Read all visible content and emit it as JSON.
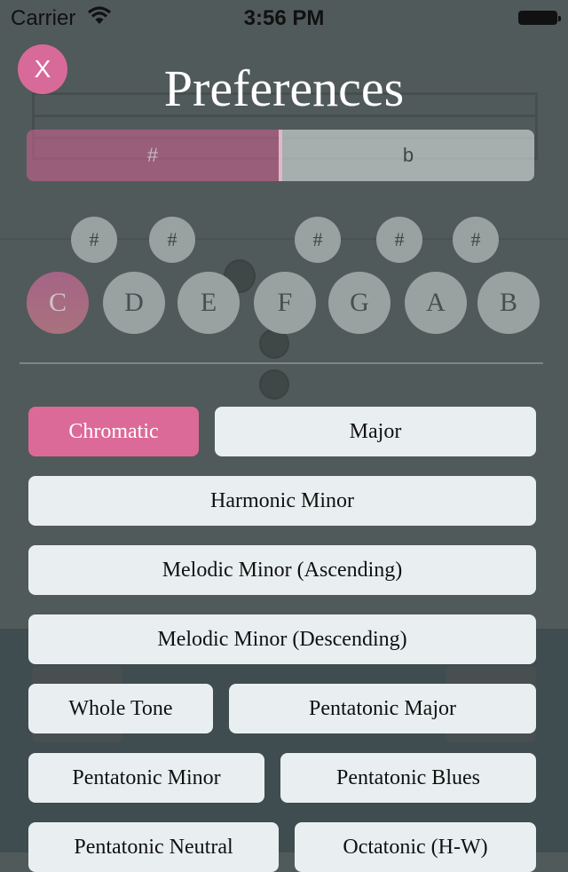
{
  "status_bar": {
    "carrier": "Carrier",
    "time": "3:56 PM"
  },
  "header": {
    "close_label": "X",
    "title": "Preferences"
  },
  "accidental_toggle": {
    "options": [
      {
        "label": "#",
        "selected": true
      },
      {
        "label": "b",
        "selected": false
      }
    ]
  },
  "accidental_keys": [
    {
      "label": "#"
    },
    {
      "label": "#"
    },
    {
      "label": "#"
    },
    {
      "label": "#"
    },
    {
      "label": "#"
    }
  ],
  "natural_keys": [
    {
      "label": "C",
      "selected": true
    },
    {
      "label": "D",
      "selected": false
    },
    {
      "label": "E",
      "selected": false
    },
    {
      "label": "F",
      "selected": false
    },
    {
      "label": "G",
      "selected": false
    },
    {
      "label": "A",
      "selected": false
    },
    {
      "label": "B",
      "selected": false
    }
  ],
  "scales": [
    {
      "label": "Chromatic",
      "selected": true
    },
    {
      "label": "Major",
      "selected": false
    },
    {
      "label": "Harmonic Minor",
      "selected": false
    },
    {
      "label": "Melodic Minor (Ascending)",
      "selected": false
    },
    {
      "label": "Melodic Minor (Descending)",
      "selected": false
    },
    {
      "label": "Whole Tone",
      "selected": false
    },
    {
      "label": "Pentatonic Major",
      "selected": false
    },
    {
      "label": "Pentatonic Minor",
      "selected": false
    },
    {
      "label": "Pentatonic Blues",
      "selected": false
    },
    {
      "label": "Pentatonic Neutral",
      "selected": false
    },
    {
      "label": "Octatonic (H-W)",
      "selected": false
    }
  ],
  "colors": {
    "accent": "#dc6a98",
    "overlay": "#515a5a",
    "button": "#e9eff0"
  }
}
